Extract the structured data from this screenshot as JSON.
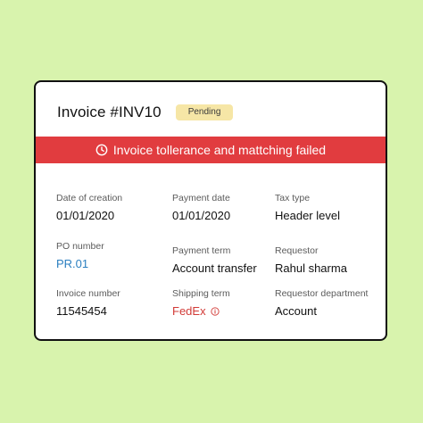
{
  "invoice": {
    "title": "Invoice #INV10",
    "status": "Pending"
  },
  "alert": {
    "icon": "clock-icon",
    "message": "Invoice tollerance and mattching failed",
    "color": "#e13c3f"
  },
  "fields": {
    "date_of_creation": {
      "label": "Date of creation",
      "value": "01/01/2020"
    },
    "payment_date": {
      "label": "Payment date",
      "value": "01/01/2020"
    },
    "tax_type": {
      "label": "Tax type",
      "value": "Header level"
    },
    "po_number": {
      "label": "PO number",
      "value": "PR.01"
    },
    "payment_term": {
      "label": "Payment term",
      "value": "Account transfer"
    },
    "requestor": {
      "label": "Requestor",
      "value": "Rahul sharma"
    },
    "invoice_number": {
      "label": "Invoice number",
      "value": "11545454"
    },
    "shipping_term": {
      "label": "Shipping term",
      "value": "FedEx",
      "icon": "info-icon"
    },
    "requestor_department": {
      "label": "Requestor department",
      "value": "Account"
    }
  },
  "colors": {
    "background": "#d8f3ad",
    "badge": "#f6e6a6",
    "link": "#2b7fc0",
    "warning": "#d23b37"
  }
}
